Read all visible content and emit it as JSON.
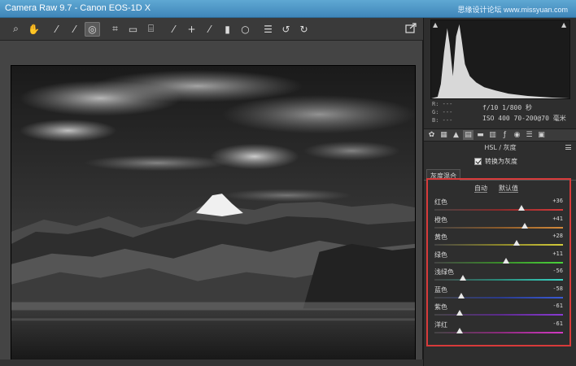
{
  "window": {
    "title": "Camera Raw 9.7 -  Canon EOS-1D X",
    "watermark": "思缘设计论坛 www.missyuan.com"
  },
  "toolbar": {
    "tools": [
      {
        "icon": "zoom-icon",
        "glyph": "⌕"
      },
      {
        "icon": "hand-icon",
        "glyph": "✋"
      },
      {
        "icon": "white-balance-icon",
        "glyph": "⁄"
      },
      {
        "icon": "color-sampler-icon",
        "glyph": "⁄"
      },
      {
        "icon": "targeted-adjustment-icon",
        "glyph": "◎"
      },
      {
        "icon": "crop-icon",
        "glyph": "⌗"
      },
      {
        "icon": "straighten-icon",
        "glyph": "▭"
      },
      {
        "icon": "transform-icon",
        "glyph": "⌸"
      },
      {
        "icon": "spot-removal-icon",
        "glyph": "⁄"
      },
      {
        "icon": "red-eye-icon",
        "glyph": "+"
      },
      {
        "icon": "adjustment-brush-icon",
        "glyph": "⁄"
      },
      {
        "icon": "graduated-filter-icon",
        "glyph": "▮"
      },
      {
        "icon": "radial-filter-icon",
        "glyph": "○"
      },
      {
        "icon": "preferences-icon",
        "glyph": "☰"
      },
      {
        "icon": "rotate-left-icon",
        "glyph": "↺"
      },
      {
        "icon": "rotate-right-icon",
        "glyph": "↻"
      }
    ],
    "active_tool": "targeted-adjustment-icon",
    "export_icon": "export-icon"
  },
  "histogram": {
    "readout": [
      "R:  ---",
      "G:  ---",
      "B:  ---"
    ],
    "exif_line1": "f/10   1/800 秒",
    "exif_line2": "ISO 400   70-200@70 毫米"
  },
  "panel_tabs": [
    "basic-icon",
    "tone-curve-icon",
    "detail-icon",
    "hsl-icon",
    "split-toning-icon",
    "lens-icon",
    "fx-icon",
    "camera-calibration-icon",
    "presets-icon",
    "snapshots-icon"
  ],
  "section": {
    "title": "HSL / 灰度",
    "convert_label": "转换为灰度",
    "subtab": "灰度混合",
    "auto": "自动",
    "default": "默认值"
  },
  "sliders": [
    {
      "name": "红色",
      "value": "+36",
      "pos": 0.68,
      "gradient": "linear-gradient(90deg,#444,#8a2a2a,#d43a3a)"
    },
    {
      "name": "橙色",
      "value": "+41",
      "pos": 0.7,
      "gradient": "linear-gradient(90deg,#444,#8a5a2a,#d48a3a)"
    },
    {
      "name": "黄色",
      "value": "+28",
      "pos": 0.64,
      "gradient": "linear-gradient(90deg,#444,#8a842a,#d4cc3a)"
    },
    {
      "name": "绿色",
      "value": "+11",
      "pos": 0.555,
      "gradient": "linear-gradient(90deg,#444,#3a8a2a,#4ad43a)"
    },
    {
      "name": "浅绿色",
      "value": "-56",
      "pos": 0.22,
      "gradient": "linear-gradient(90deg,#444,#2a8a7a,#3ad4c4)"
    },
    {
      "name": "蓝色",
      "value": "-58",
      "pos": 0.21,
      "gradient": "linear-gradient(90deg,#444,#2a3a8a,#3a5ad4)"
    },
    {
      "name": "紫色",
      "value": "-61",
      "pos": 0.195,
      "gradient": "linear-gradient(90deg,#444,#5a2a8a,#8a3ad4)"
    },
    {
      "name": "洋红",
      "value": "-61",
      "pos": 0.195,
      "gradient": "linear-gradient(90deg,#444,#8a2a7a,#d43ac4)"
    }
  ],
  "highlight_color": "#d83a3a"
}
